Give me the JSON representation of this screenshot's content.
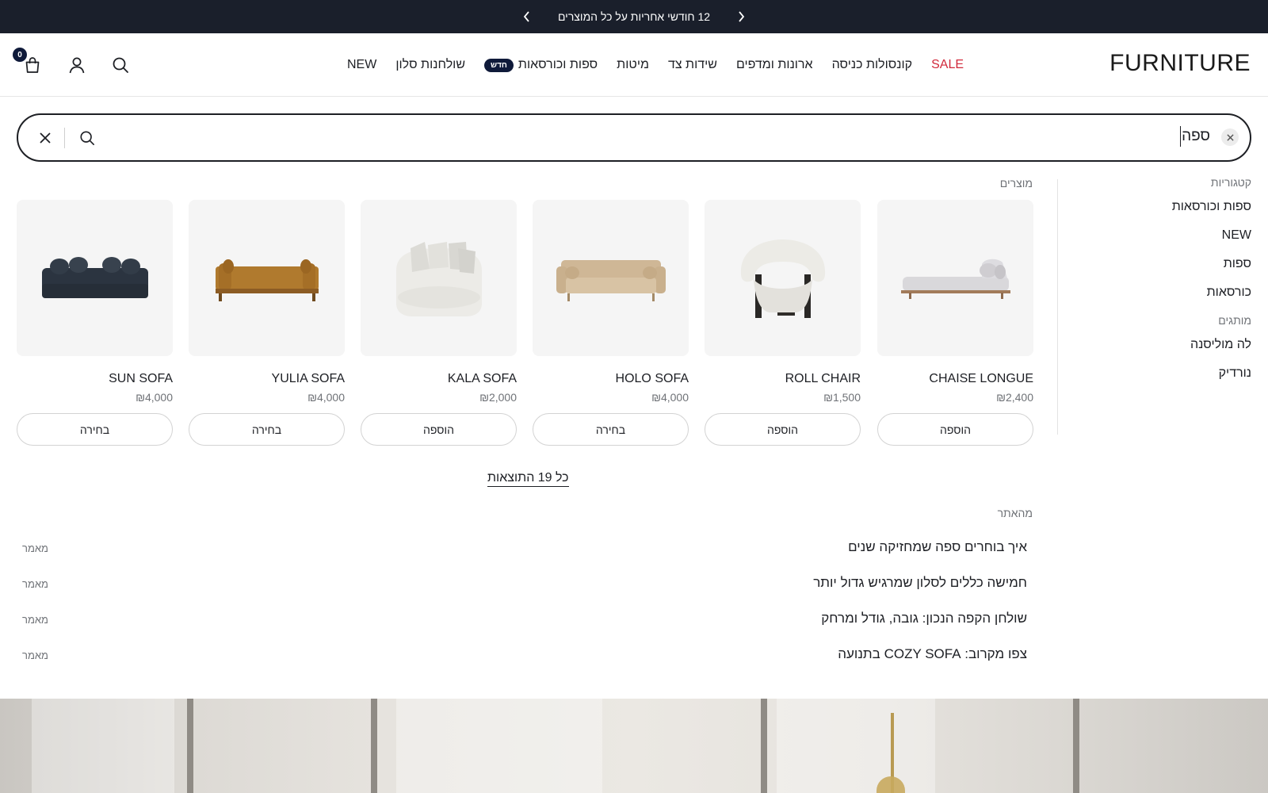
{
  "announcement": {
    "text": "12 חודשי אחריות על כל המוצרים",
    "prev_icon": "chevron-left-icon",
    "next_icon": "chevron-right-icon"
  },
  "header": {
    "logo": "FURNITURE",
    "nav": [
      {
        "label": "NEW"
      },
      {
        "label": "שולחנות סלון"
      },
      {
        "label": "ספות וכורסאות",
        "badge": "חדש"
      },
      {
        "label": "מיטות"
      },
      {
        "label": "שידות צד"
      },
      {
        "label": "ארונות ומדפים"
      },
      {
        "label": "קונסולות כניסה"
      },
      {
        "label": "SALE",
        "sale": true
      }
    ],
    "cart_count": "0",
    "icons": [
      "search-icon",
      "account-icon",
      "cart-icon"
    ]
  },
  "search": {
    "query": "ספה"
  },
  "sidebar": {
    "categories_heading": "קטגוריות",
    "categories": [
      "ספות וכורסאות",
      "NEW",
      "ספות",
      "כורסאות"
    ],
    "brands_heading": "מותגים",
    "brands": [
      "לה מוליסנה",
      "נורדיק"
    ]
  },
  "products": {
    "heading": "מוצרים",
    "items": [
      {
        "name": "CHAISE LONGUE",
        "price": "₪2,400",
        "button": "הוספה"
      },
      {
        "name": "ROLL CHAIR",
        "price": "₪1,500",
        "button": "הוספה"
      },
      {
        "name": "HOLO SOFA",
        "price": "₪4,000",
        "button": "בחירה"
      },
      {
        "name": "KALA SOFA",
        "price": "₪2,000",
        "button": "הוספה"
      },
      {
        "name": "YULIA SOFA",
        "price": "₪4,000",
        "button": "בחירה"
      },
      {
        "name": "SUN SOFA",
        "price": "₪4,000",
        "button": "בחירה"
      }
    ],
    "all_results": "כל 19 התוצאות"
  },
  "articles": {
    "heading": "מהאתר",
    "items": [
      {
        "title": "איך בוחרים ספה שמחזיקה שנים",
        "type": "מאמר"
      },
      {
        "title": "חמישה כללים לסלון שמרגיש גדול יותר",
        "type": "מאמר"
      },
      {
        "title": "שולחן הקפה הנכון: גובה, גודל ומרחק",
        "type": "מאמר"
      },
      {
        "title": "צפו מקרוב: COZY SOFA בתנועה",
        "type": "מאמר"
      }
    ]
  },
  "colors": {
    "announcement_bg": "#1a1f2b",
    "badge_bg": "#0f1a3a",
    "sale": "#d1293b"
  }
}
